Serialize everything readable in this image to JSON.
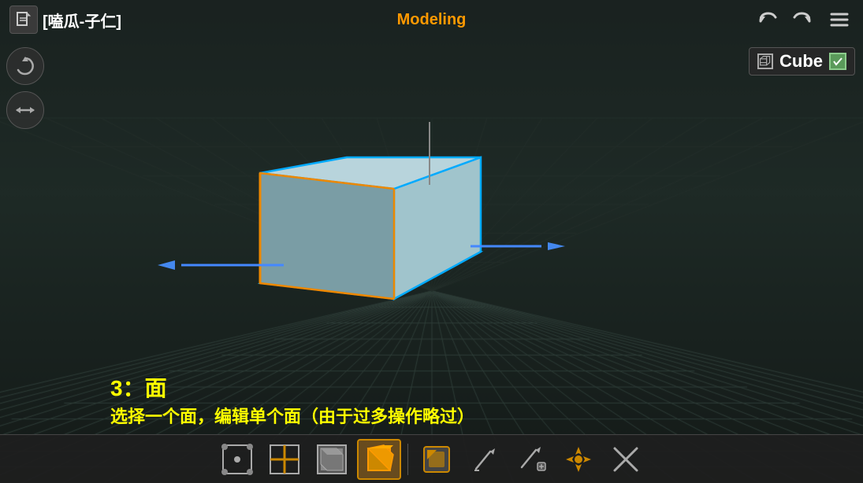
{
  "top": {
    "title": "[嗑瓜-子仁]",
    "mode": "Modeling",
    "undo_label": "↩",
    "redo_label": "↪",
    "menu_label": "☰"
  },
  "object_panel": {
    "name": "Cube",
    "icon": "□"
  },
  "left_controls": {
    "rotate_icon": "↺",
    "pan_icon": "⇆"
  },
  "bottom_text": {
    "line1": "3：面",
    "line2": "选择一个面，编辑单个面（由于过多操作略过）"
  },
  "toolbar": {
    "buttons": [
      {
        "id": "vertex-mode",
        "label": "⬡",
        "active": false
      },
      {
        "id": "edge-mode",
        "label": "⬡",
        "active": false
      },
      {
        "id": "face-mode",
        "label": "⬡",
        "active": false
      },
      {
        "id": "face-mode-active",
        "label": "⬡",
        "active": true
      },
      {
        "id": "select-tool",
        "label": "▣",
        "active": false
      },
      {
        "id": "edit-tool",
        "label": "✏",
        "active": false
      },
      {
        "id": "edit2-tool",
        "label": "✏",
        "active": false
      },
      {
        "id": "transform-tool",
        "label": "◈",
        "active": false
      },
      {
        "id": "delete-tool",
        "label": "✕",
        "active": false
      }
    ]
  },
  "colors": {
    "background": "#1e2520",
    "grid": "#2a3330",
    "orange_accent": "#ff9900",
    "yellow_text": "#ffff00",
    "blue_axis": "#4488ff",
    "cube_face": "#8ab0b8",
    "cube_edge_selected": "#00aaff",
    "cube_edge_orange": "#ee8800"
  }
}
